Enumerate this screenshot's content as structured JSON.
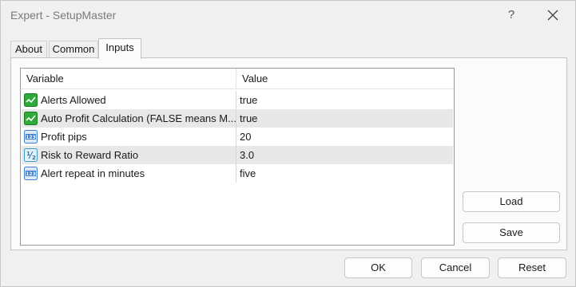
{
  "window": {
    "title": "Expert - SetupMaster",
    "help_label": "?"
  },
  "tabs": [
    {
      "label": "About",
      "active": false
    },
    {
      "label": "Common",
      "active": false
    },
    {
      "label": "Inputs",
      "active": true
    }
  ],
  "grid": {
    "columns": [
      "Variable",
      "Value"
    ],
    "rows": [
      {
        "icon": "boolean-icon",
        "variable": "Alerts Allowed",
        "value": "true"
      },
      {
        "icon": "boolean-icon",
        "variable": "Auto Profit Calculation (FALSE means M...",
        "value": "true"
      },
      {
        "icon": "integer-icon",
        "variable": "Profit pips",
        "value": "20"
      },
      {
        "icon": "double-icon",
        "variable": "Risk to Reward Ratio",
        "value": "3.0"
      },
      {
        "icon": "integer-icon",
        "variable": "Alert repeat in minutes",
        "value": "five"
      }
    ]
  },
  "side_buttons": {
    "load": "Load",
    "save": "Save"
  },
  "footer_buttons": {
    "ok": "OK",
    "cancel": "Cancel",
    "reset": "Reset"
  },
  "colors": {
    "alt_row": "#e8e8e8",
    "boolean_icon": "#2faa3a",
    "numeric_icon": "#3f7fc9"
  }
}
